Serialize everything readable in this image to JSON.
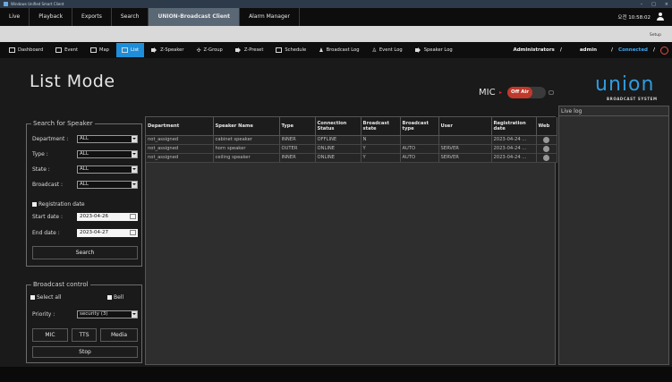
{
  "titlebar": {
    "app_title": "Windows Unified Smart Client",
    "controls": [
      "–",
      "□",
      "×"
    ]
  },
  "topmenu": {
    "items": [
      "Live",
      "Playback",
      "Exports",
      "Search",
      "UNION-Broadcast Client",
      "Alarm Manager"
    ],
    "active": "UNION-Broadcast Client",
    "clock": "오전 10:58:02"
  },
  "setup": {
    "label": "Setup"
  },
  "toolbar": {
    "items": [
      {
        "label": "Dashboard",
        "icon": "grid-icon"
      },
      {
        "label": "Event",
        "icon": "monitor-icon"
      },
      {
        "label": "Map",
        "icon": "map-icon"
      },
      {
        "label": "List",
        "icon": "list-icon"
      },
      {
        "label": "Z-Speaker",
        "icon": "speaker-icon"
      },
      {
        "label": "Z-Group",
        "icon": "group-icon"
      },
      {
        "label": "Z-Preset",
        "icon": "speaker-icon"
      },
      {
        "label": "Schedule",
        "icon": "calendar-icon"
      },
      {
        "label": "Broadcast Log",
        "icon": "people-icon"
      },
      {
        "label": "Event Log",
        "icon": "person-icon"
      },
      {
        "label": "Speaker Log",
        "icon": "speaker-icon"
      }
    ],
    "active": "List",
    "role": "Administrators",
    "sep": "/",
    "user": "admin",
    "status": "Connected"
  },
  "header": {
    "title": "List Mode",
    "mic_label": "MIC",
    "offair_label": "Off Air",
    "logo_word": "union",
    "logo_sub": "BROADCAST SYSTEM"
  },
  "search": {
    "legend": "Search for Speaker",
    "department_label": "Department :",
    "department_value": "ALL",
    "type_label": "Type :",
    "type_value": "ALL",
    "state_label": "State :",
    "state_value": "ALL",
    "broadcast_label": "Broadcast :",
    "broadcast_value": "ALL",
    "registration_label": "Registration date",
    "start_label": "Start date :",
    "start_value": "2023-04-26",
    "end_label": "End date :",
    "end_value": "2023-04-27",
    "button": "Search"
  },
  "broadcast": {
    "legend": "Broadcast control",
    "select_all": "Select all",
    "bell": "Bell",
    "priority_label": "Priority :",
    "priority_value": "security (3)",
    "mic_btn": "MIC",
    "tts_btn": "TTS",
    "media_btn": "Media",
    "stop_btn": "Stop"
  },
  "table": {
    "headers": [
      "Department",
      "Speaker Name",
      "Type",
      "Connection Status",
      "Broadcast state",
      "Broadcast type",
      "User",
      "Registration date",
      "Web"
    ],
    "rows": [
      [
        "not_assigned",
        "cabinet speaker",
        "INNER",
        "OFFLINE",
        "N",
        "",
        "",
        "2023-04-24 ..."
      ],
      [
        "not_assigned",
        "horn speaker",
        "OUTER",
        "ONLINE",
        "Y",
        "AUTO",
        "SERVER",
        "2023-04-24 ..."
      ],
      [
        "not_assigned",
        "ceiling speaker",
        "INNER",
        "ONLINE",
        "Y",
        "AUTO",
        "SERVER",
        "2023-04-24 ..."
      ]
    ]
  },
  "livelog": {
    "title": "Live log"
  }
}
